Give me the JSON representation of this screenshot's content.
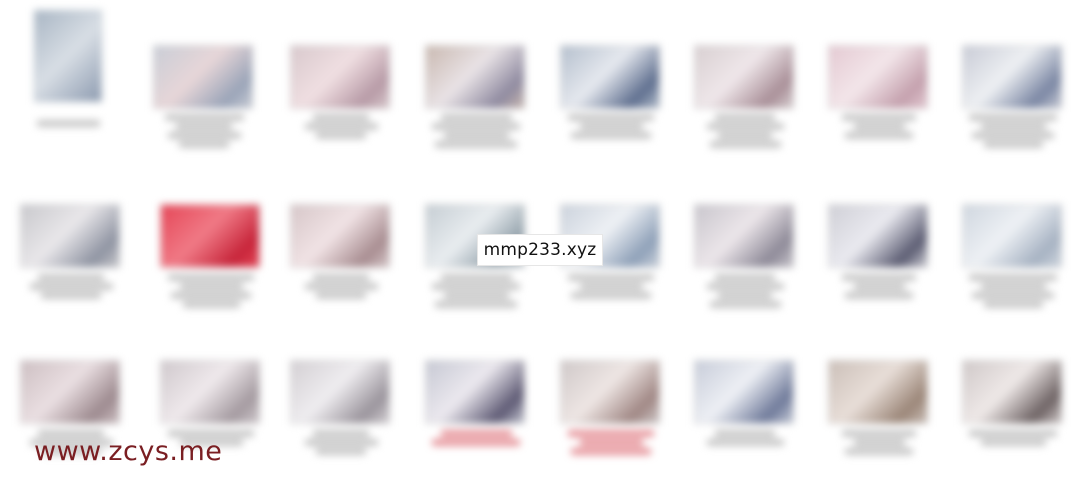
{
  "overlay": {
    "watermark": "mmp233.xyz",
    "site": "www.zcys.me"
  },
  "colors": {
    "site_text": "#7a1e22",
    "red_caption": "#c0303a",
    "caption_gray": "#6a6a6a"
  }
}
